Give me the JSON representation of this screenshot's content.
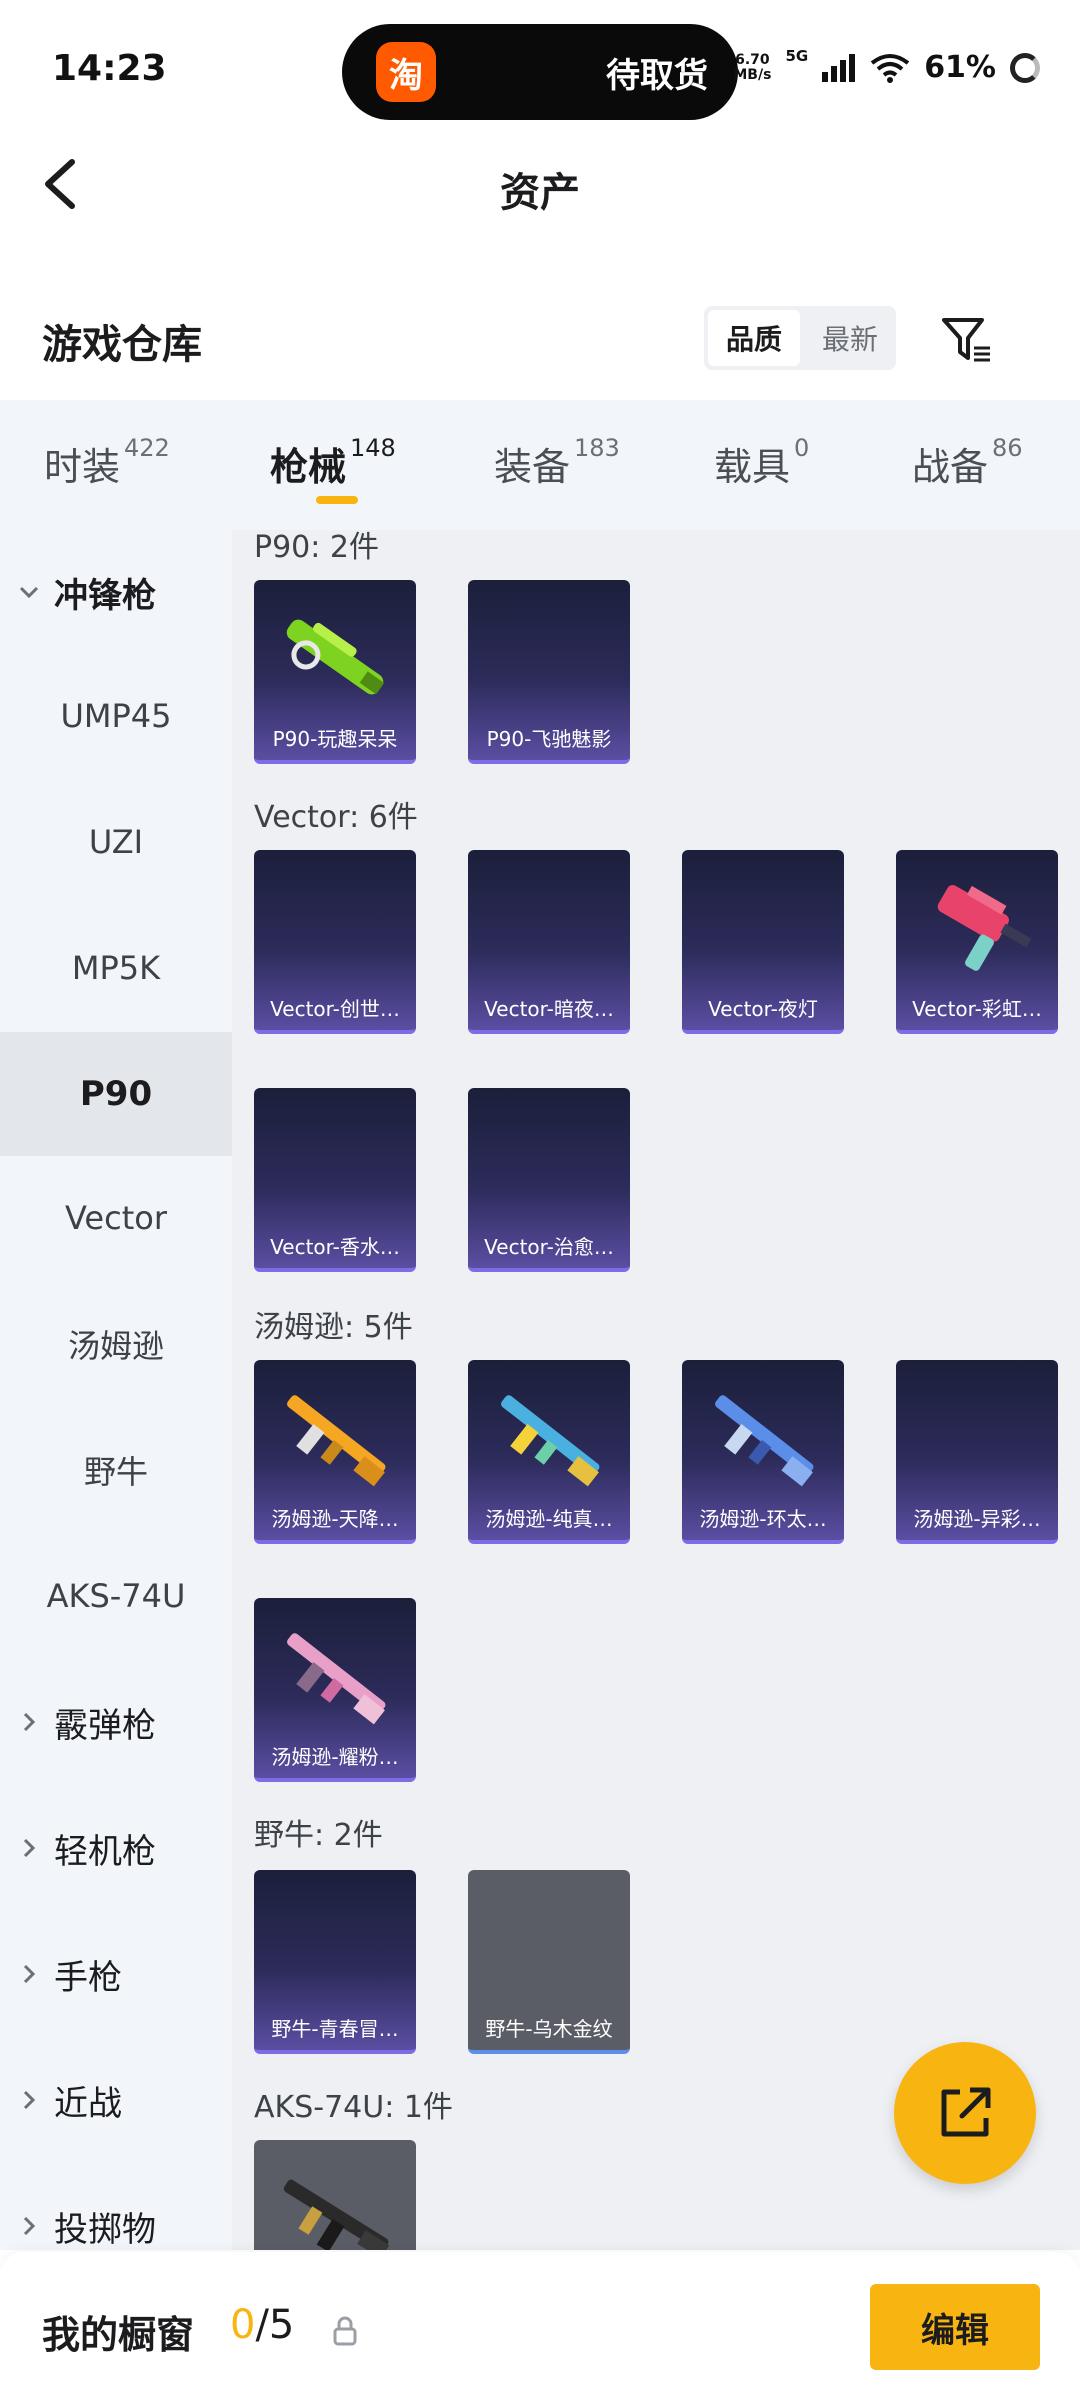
{
  "status_bar": {
    "time": "14:23",
    "island_app_icon": "淘",
    "island_text": "待取货",
    "net_speed_value": "6.70",
    "net_speed_unit": "MB/s",
    "network": "5G",
    "battery": "61%"
  },
  "nav": {
    "title": "资产"
  },
  "warehouse": {
    "title": "游戏仓库",
    "sort_options": [
      "品质",
      "最新"
    ],
    "sort_selected": "品质"
  },
  "tabs": [
    {
      "label": "时装",
      "count": "422"
    },
    {
      "label": "枪械",
      "count": "148",
      "active": true
    },
    {
      "label": "装备",
      "count": "183"
    },
    {
      "label": "载具",
      "count": "0"
    },
    {
      "label": "战备",
      "count": "86"
    }
  ],
  "sidebar": [
    {
      "label": "冲锋枪",
      "type": "group",
      "expanded": true
    },
    {
      "label": "UMP45"
    },
    {
      "label": "UZI"
    },
    {
      "label": "MP5K"
    },
    {
      "label": "P90",
      "active": true
    },
    {
      "label": "Vector"
    },
    {
      "label": "汤姆逊"
    },
    {
      "label": "野牛"
    },
    {
      "label": "AKS-74U"
    },
    {
      "label": "霰弹枪",
      "type": "group"
    },
    {
      "label": "轻机枪",
      "type": "group"
    },
    {
      "label": "手枪",
      "type": "group"
    },
    {
      "label": "近战",
      "type": "group"
    },
    {
      "label": "投掷物",
      "type": "group"
    }
  ],
  "groups": [
    {
      "title": "P90: 2件",
      "items": [
        {
          "label": "P90-玩趣呆呆",
          "art": "green"
        },
        {
          "label": "P90-飞驰魅影"
        }
      ]
    },
    {
      "title": "Vector: 6件",
      "items": [
        {
          "label": "Vector-创世…"
        },
        {
          "label": "Vector-暗夜…"
        },
        {
          "label": "Vector-夜灯"
        },
        {
          "label": "Vector-彩虹…",
          "art": "pink"
        },
        {
          "label": "Vector-香水…"
        },
        {
          "label": "Vector-治愈…"
        }
      ]
    },
    {
      "title": "汤姆逊: 5件",
      "items": [
        {
          "label": "汤姆逊-天降…",
          "art": "gold"
        },
        {
          "label": "汤姆逊-纯真…",
          "art": "teal"
        },
        {
          "label": "汤姆逊-环太…",
          "art": "blue"
        },
        {
          "label": "汤姆逊-异彩…"
        },
        {
          "label": "汤姆逊-耀粉…",
          "art": "rose"
        }
      ]
    },
    {
      "title": "野牛: 2件",
      "items": [
        {
          "label": "野牛-青春冒…"
        },
        {
          "label": "野牛-乌木金纹",
          "tone": "gray"
        }
      ]
    },
    {
      "title": "AKS-74U: 1件",
      "items": [
        {
          "label": "",
          "tone": "gray",
          "art": "black"
        }
      ]
    }
  ],
  "showcase": {
    "label": "我的橱窗",
    "used": "0",
    "total": "/5"
  },
  "edit_button": "编辑",
  "colors": {
    "accent": "#f8b410",
    "card_bg": "#2c2b5a",
    "card_border": "#7d6ce6"
  },
  "icons": {
    "back": "chevron-left-icon",
    "filter": "filter-icon",
    "fab": "share-external-icon",
    "lock": "lock-icon"
  }
}
